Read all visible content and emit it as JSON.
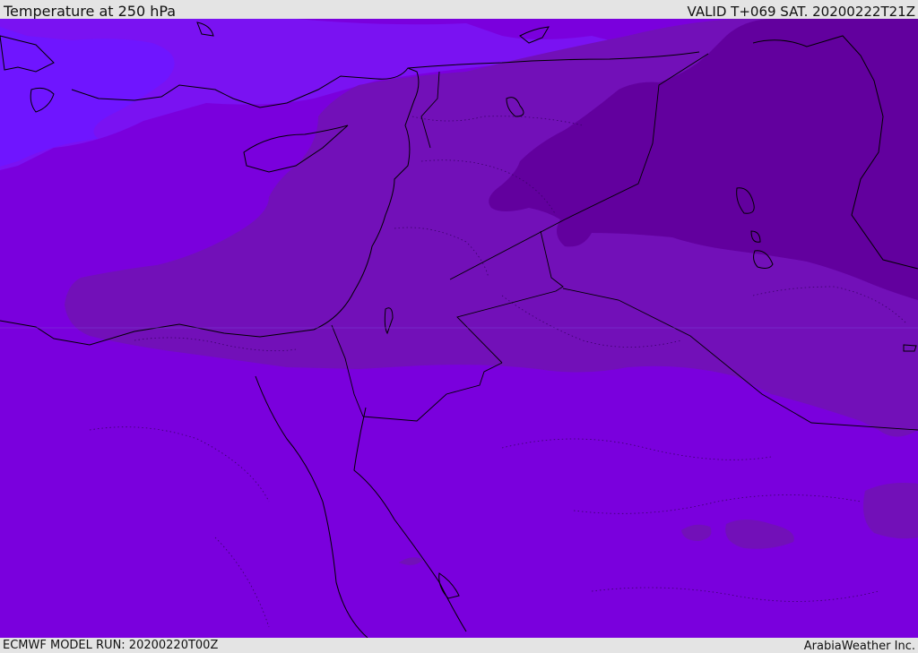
{
  "header": {
    "title": "Temperature at 250 hPa",
    "valid": "VALID T+069 SAT. 20200222T21Z"
  },
  "footer": {
    "model_run": "ECMWF MODEL RUN: 20200220T00Z",
    "brand": "ArabiaWeather Inc."
  },
  "map": {
    "colors": {
      "band_coldest": "#62009e",
      "band_cold": "#7210b8",
      "band_main": "#7a00dd",
      "band_warm": "#7a12f2",
      "band_warmest": "#6f15ff",
      "coastline": "#000000"
    }
  }
}
